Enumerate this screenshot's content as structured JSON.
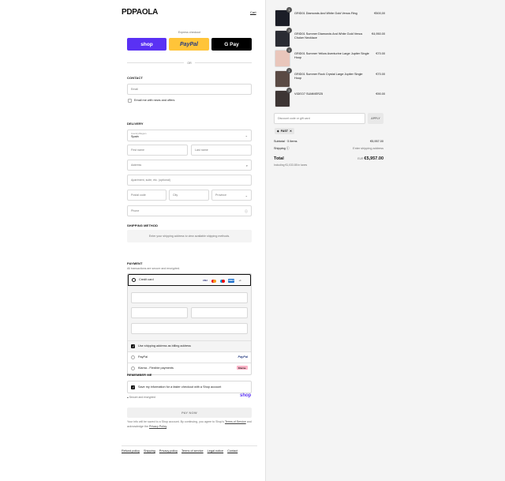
{
  "brand": {
    "logo": "PDPAOLA",
    "cart_link": "Cart"
  },
  "express": {
    "title": "Express checkout",
    "shop": "shop",
    "paypal": "PayPal",
    "gpay": "G Pay",
    "or": "OR"
  },
  "contact": {
    "heading": "CONTACT",
    "email_placeholder": "Email",
    "newsletter_label": "Email me with news and offers"
  },
  "delivery": {
    "heading": "DELIVERY",
    "country_label": "Country/Region",
    "country_value": "Spain",
    "first_name": "First name",
    "last_name": "Last name",
    "address": "Address",
    "apartment": "Apartment, suite, etc. (optional)",
    "postal": "Postal code",
    "city": "City",
    "province": "Province",
    "phone": "Phone"
  },
  "shipping": {
    "heading": "SHIPPING METHOD",
    "message": "Enter your shipping address to view available shipping methods."
  },
  "payment": {
    "heading": "PAYMENT",
    "subtitle": "All transactions are secure and encrypted.",
    "credit_card": "Credit card",
    "cards": [
      "VISA",
      "MC",
      "MAE",
      "AMEX"
    ],
    "more_cards": "+4",
    "billing_same": "Use shipping address as billing address",
    "paypal": "PayPal",
    "paypal_logo": "PayPal",
    "klarna": "Klarna - Flexible payments",
    "klarna_logo": "Klarna."
  },
  "remember": {
    "heading": "REMEMBER ME",
    "save_label": "Save my information for a faster checkout with a Shop account",
    "secure": "Secure and encrypted",
    "shop_logo": "shop"
  },
  "pay_now": "PAY NOW",
  "legal": {
    "text1": "Your info will be saved to a Shop account. By continuing, you agree to Shop's ",
    "terms": "Terms of Service",
    "text2": " and acknowledge the ",
    "privacy": "Privacy Policy",
    "text3": "."
  },
  "footer": [
    "Refund policy",
    "Shipping",
    "Privacy policy",
    "Terms of service",
    "Legal notice",
    "Contact"
  ],
  "order": {
    "items": [
      {
        "qty": "1",
        "name": "GRID01 Diamonds And White Gold Venus Ring",
        "price": "€500,00",
        "color": "#1b1d27"
      },
      {
        "qty": "1",
        "name": "GRID01 Summer Diamonds And White Gold Venus Choker Necklace",
        "price": "€4,950.00",
        "color": "#2a2c33"
      },
      {
        "qty": "1",
        "name": "GRID01 Summer Yellow Aventurine Large Jupiter Single Hoop",
        "price": "€70.00",
        "color": "#e9c6bb"
      },
      {
        "qty": "1",
        "name": "GRID01 Summer Rock Crystal Large Jupiter Single Hoop",
        "price": "€70.00",
        "color": "#5a4a44"
      },
      {
        "qty": "1",
        "name": "VIDEO7 SUMMER25",
        "price": "€90.00",
        "color": "#3d3534"
      }
    ],
    "discount_placeholder": "Discount code or gift card",
    "apply": "APPLY",
    "applied_code": "FAST",
    "subtotal_label": "Subtotal · 5 items",
    "subtotal_value": "€5,957.00",
    "shipping_label": "Shipping",
    "shipping_value": "Enter shipping address",
    "total_label": "Total",
    "currency": "EUR",
    "total_value": "€5,957.00",
    "taxes": "Including €1,033.85 in taxes"
  }
}
